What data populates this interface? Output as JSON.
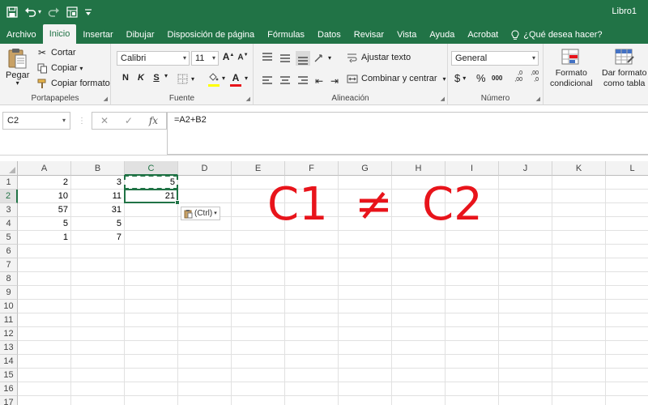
{
  "window": {
    "title": "Libro1"
  },
  "qat": {
    "save_icon": "save-icon",
    "undo_icon": "undo-icon",
    "redo_icon": "redo-icon",
    "form_icon": "form-icon",
    "customize_icon": "customize-icon"
  },
  "tabs": [
    {
      "label": "Archivo"
    },
    {
      "label": "Inicio"
    },
    {
      "label": "Insertar"
    },
    {
      "label": "Dibujar"
    },
    {
      "label": "Disposición de página"
    },
    {
      "label": "Fórmulas"
    },
    {
      "label": "Datos"
    },
    {
      "label": "Revisar"
    },
    {
      "label": "Vista"
    },
    {
      "label": "Ayuda"
    },
    {
      "label": "Acrobat"
    }
  ],
  "tell_me": "¿Qué desea hacer?",
  "ribbon": {
    "clipboard": {
      "label": "Portapapeles",
      "paste": "Pegar",
      "cut": "Cortar",
      "copy": "Copiar",
      "format_painter": "Copiar formato"
    },
    "font": {
      "label": "Fuente",
      "name": "Calibri",
      "size": "11",
      "bold": "N",
      "italic": "K",
      "underline": "S",
      "grow": "A",
      "shrink": "A",
      "font_color_letter": "A",
      "fill_color": "#ffff00",
      "font_color": "#e8141b"
    },
    "alignment": {
      "label": "Alineación",
      "wrap": "Ajustar texto",
      "merge": "Combinar y centrar"
    },
    "number": {
      "label": "Número",
      "format": "General",
      "currency": "$",
      "percent": "%",
      "thousands": "000",
      "inc_decimal": ",0 ,00",
      "dec_decimal": ",00 ,0"
    },
    "styles": {
      "conditional_line1": "Formato",
      "conditional_line2": "condicional",
      "table_line1": "Dar formato",
      "table_line2": "como tabla"
    }
  },
  "formula_bar": {
    "name_box": "C2",
    "formula": "=A2+B2"
  },
  "columns": [
    "A",
    "B",
    "C",
    "D",
    "E",
    "F",
    "G",
    "H",
    "I",
    "J",
    "K",
    "L"
  ],
  "rows": [
    "1",
    "2",
    "3",
    "4",
    "5",
    "6",
    "7",
    "8",
    "9",
    "10",
    "11",
    "12",
    "13",
    "14",
    "15",
    "16",
    "17"
  ],
  "cells": {
    "A1": "2",
    "B1": "3",
    "C1": "5",
    "A2": "10",
    "B2": "11",
    "C2": "21",
    "A3": "57",
    "B3": "31",
    "A4": "5",
    "B4": "5",
    "A5": "1",
    "B5": "7"
  },
  "paste_options": "(Ctrl)",
  "annotation": {
    "left": "C1",
    "symbol": "≠",
    "right": "C2"
  },
  "colors": {
    "excel_green": "#217346",
    "annotation_red": "#e8141b"
  }
}
